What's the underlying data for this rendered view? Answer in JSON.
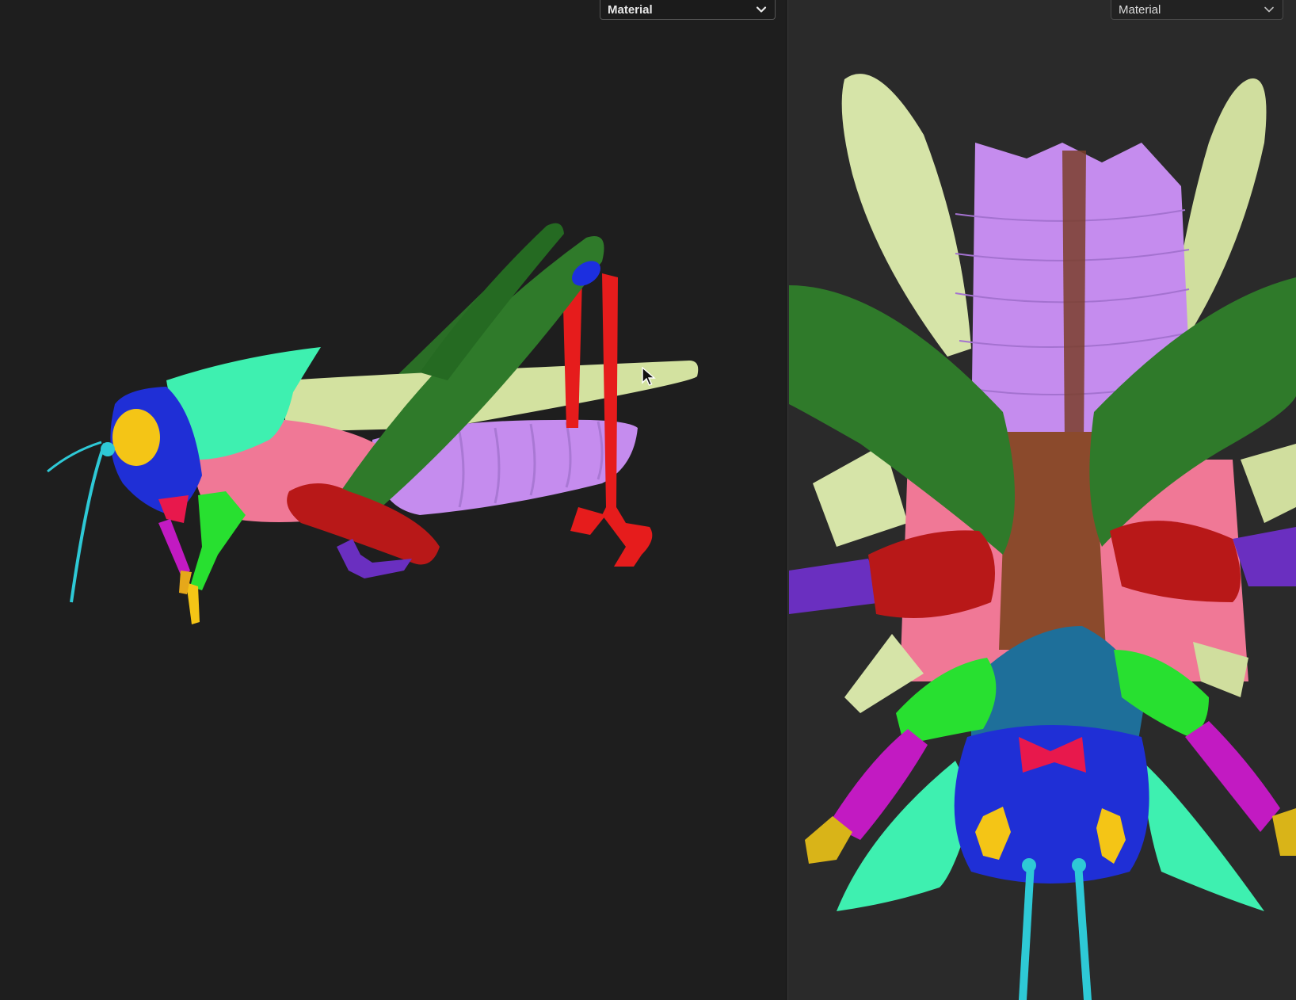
{
  "viewports": {
    "left": {
      "shading_mode": "Material"
    },
    "right": {
      "shading_mode": "Material"
    }
  },
  "icons": {
    "dropdown": "chevron-down-icon",
    "cursor": "arrow-cursor-icon"
  },
  "colors": {
    "viewport_bg_left": "#1e1e1e",
    "viewport_bg_right": "#2a2a2a",
    "head": "#1f2fd6",
    "eye": "#f4c516",
    "antenna": "#2ec9d6",
    "pronotum": "#3ef0b0",
    "tegmen": "#d8e8a8",
    "thorax": "#f07a98",
    "abdomen": "#c990f0",
    "hind_femur": "#2f7a2a",
    "hind_tibia": "#e81e1e",
    "mid_leg": "#c41a1a",
    "front_leg": "#c21ac2",
    "fore_femur": "#28e030",
    "ventral_midline": "#8b4a2c",
    "clypeus": "#e81a40"
  }
}
